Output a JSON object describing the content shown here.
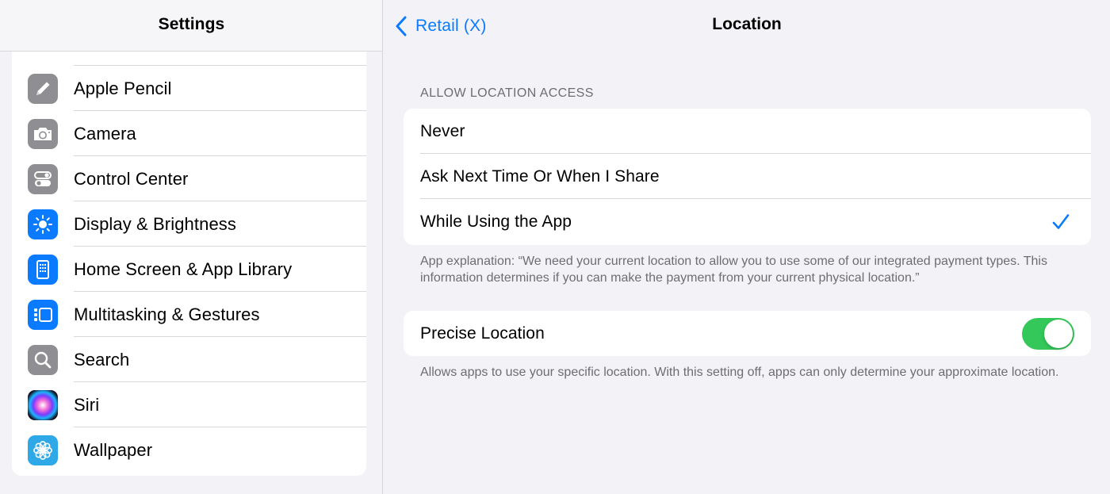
{
  "sidebar": {
    "title": "Settings",
    "items": [
      {
        "label": "Apple Pencil",
        "icon": "pencil-icon",
        "color": "#8e8e93"
      },
      {
        "label": "Camera",
        "icon": "camera-icon",
        "color": "#8e8e93"
      },
      {
        "label": "Control Center",
        "icon": "toggles-icon",
        "color": "#8e8e93"
      },
      {
        "label": "Display & Brightness",
        "icon": "sun-icon",
        "color": "#0a7aff"
      },
      {
        "label": "Home Screen & App Library",
        "icon": "home-screen-icon",
        "color": "#0a7aff"
      },
      {
        "label": "Multitasking & Gestures",
        "icon": "multitasking-icon",
        "color": "#0a7aff"
      },
      {
        "label": "Search",
        "icon": "search-icon",
        "color": "#8e8e93"
      },
      {
        "label": "Siri",
        "icon": "siri-icon",
        "color": "#1b1b2e"
      },
      {
        "label": "Wallpaper",
        "icon": "flower-icon",
        "color": "#2ea8e6"
      }
    ]
  },
  "nav": {
    "back_label": "Retail (X)",
    "title": "Location"
  },
  "location_access": {
    "header": "ALLOW LOCATION ACCESS",
    "options": [
      {
        "label": "Never",
        "selected": false
      },
      {
        "label": "Ask Next Time Or When I Share",
        "selected": false
      },
      {
        "label": "While Using the App",
        "selected": true
      }
    ],
    "footer": "App explanation: “We need your current location to allow you to use some of our integrated payment types. This information determines if you can make the payment from your current physical location.”"
  },
  "precise_location": {
    "label": "Precise Location",
    "enabled": true,
    "footer": "Allows apps to use your specific location. With this setting off, apps can only determine your approximate location."
  },
  "colors": {
    "accent": "#0a7aff",
    "toggle_on": "#34c759",
    "secondary_text": "#6d6d72"
  }
}
